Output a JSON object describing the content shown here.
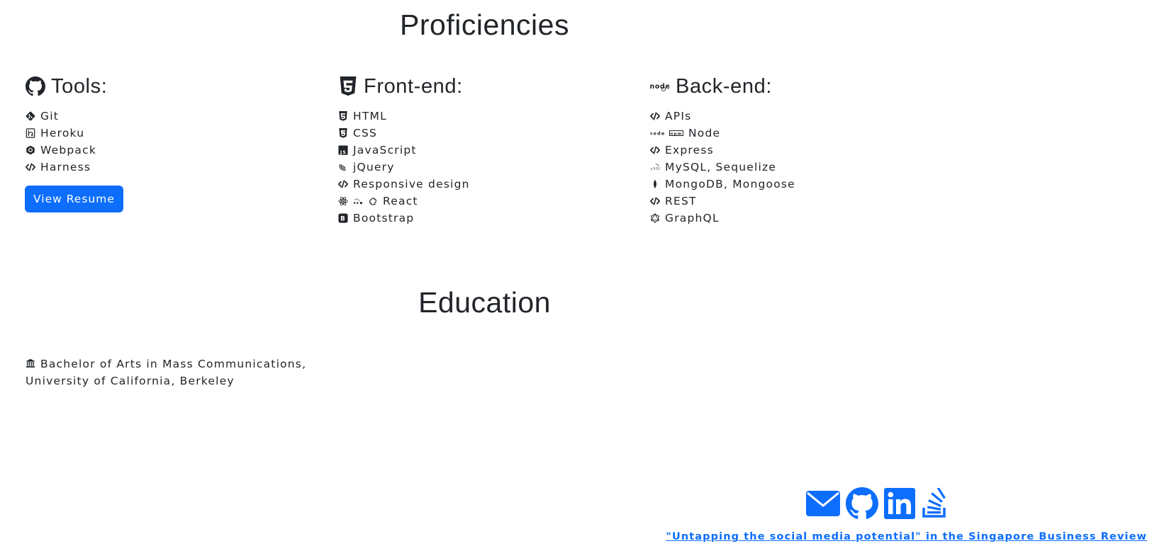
{
  "proficiencies": {
    "title": "Proficiencies",
    "tools": {
      "heading": "Tools:",
      "heading_icon": "github-icon",
      "items": [
        {
          "label": "Git",
          "icon": "git-icon"
        },
        {
          "label": "Heroku",
          "icon": "heroku-icon"
        },
        {
          "label": "Webpack",
          "icon": "webpack-icon"
        },
        {
          "label": "Harness",
          "icon": "code-icon"
        }
      ],
      "resume_button": "View Resume"
    },
    "frontend": {
      "heading": "Front-end:",
      "heading_icon": "html5-icon",
      "items": [
        {
          "label": "HTML",
          "icon": "html5-icon"
        },
        {
          "label": "CSS",
          "icon": "css3-icon"
        },
        {
          "label": "JavaScript",
          "icon": "js-icon"
        },
        {
          "label": "jQuery",
          "icon": "jquery-icon"
        },
        {
          "label": "Responsive design",
          "icon": "code-icon"
        },
        {
          "label": "React",
          "icon": "react-icon"
        },
        {
          "label": "Bootstrap",
          "icon": "bootstrap-icon"
        }
      ]
    },
    "backend": {
      "heading": "Back-end:",
      "heading_icon": "node-icon",
      "items": [
        {
          "label": "APIs",
          "icon": "code-icon"
        },
        {
          "label": "Node",
          "icon": "node-npm-icon"
        },
        {
          "label": "Express",
          "icon": "code-icon"
        },
        {
          "label": "MySQL, Sequelize",
          "icon": "mysql-icon"
        },
        {
          "label": "MongoDB, Mongoose",
          "icon": "mongodb-icon"
        },
        {
          "label": "REST",
          "icon": "code-icon"
        },
        {
          "label": "GraphQL",
          "icon": "graphql-icon"
        }
      ]
    }
  },
  "education": {
    "title": "Education",
    "entry": "Bachelor of Arts in Mass Communications, University of California, Berkeley",
    "icon": "university-icon"
  },
  "social": {
    "icons": [
      "envelope-icon",
      "github-icon",
      "linkedin-icon",
      "stack-overflow-icon"
    ]
  },
  "footer": {
    "link_text": "\"Untapping the social media potential\" in the Singapore Business Review"
  },
  "colors": {
    "accent": "#0d6efd",
    "text": "#212529",
    "background": "#ffffff"
  }
}
